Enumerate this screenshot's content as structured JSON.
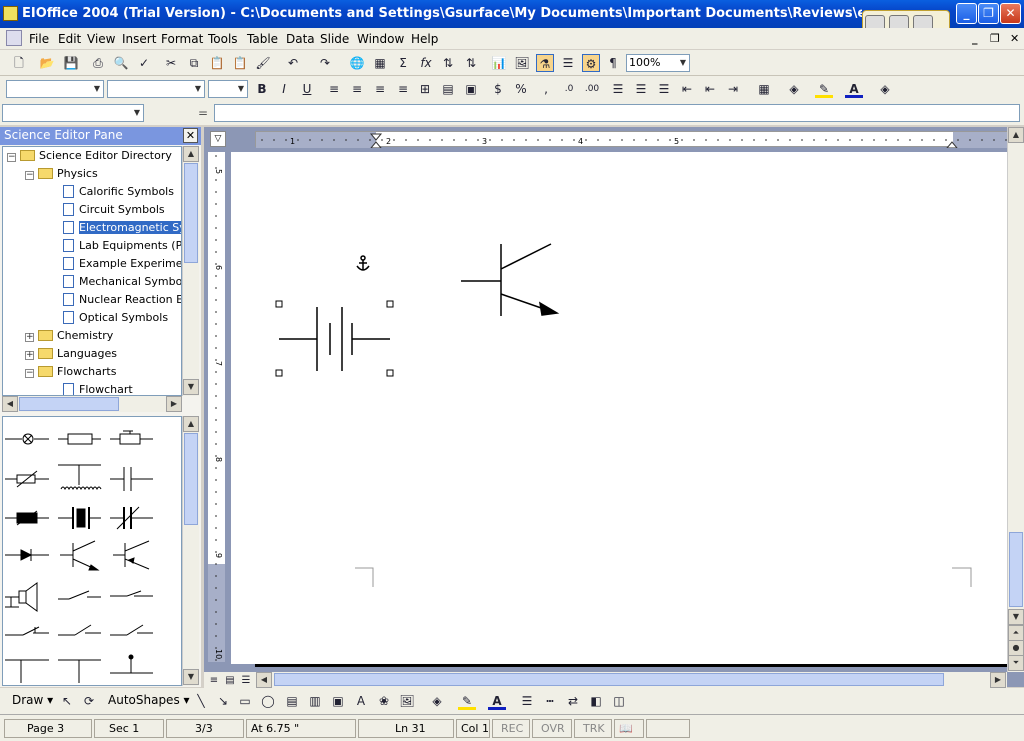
{
  "window": {
    "title": "EIOffice 2004 (Trial Version) - C:\\Documents and Settings\\Gsurface\\My Documents\\Important Documents\\Reviews\\eioffice\\EIOfficei.eio"
  },
  "menubar": {
    "items": [
      "File",
      "Edit",
      "View",
      "Insert",
      "Format",
      "Tools",
      "Table",
      "Data",
      "Slide",
      "Window",
      "Help"
    ]
  },
  "toolbar": {
    "zoom_value": "100%",
    "pilcrow": "¶",
    "sigma": "Σ",
    "fx": "fx",
    "dollar": "$",
    "percent": "%",
    "comma": ",",
    "bold": "B",
    "italic": "I",
    "underline": "U",
    "font_color_letter": "A",
    "addr_equals": "="
  },
  "pane": {
    "title": "Science Editor Pane",
    "tree": [
      {
        "label": "Science Editor Directory",
        "type": "folder",
        "level": 0,
        "expander": "−"
      },
      {
        "label": "Physics",
        "type": "folder",
        "level": 1,
        "expander": "−"
      },
      {
        "label": "Calorific Symbols",
        "type": "doc",
        "level": 2
      },
      {
        "label": "Circuit Symbols",
        "type": "doc",
        "level": 2
      },
      {
        "label": "Electromagnetic Sym",
        "type": "doc",
        "level": 2,
        "selected": true
      },
      {
        "label": "Lab Equipments (Phy",
        "type": "doc",
        "level": 2
      },
      {
        "label": "Example Experiments",
        "type": "doc",
        "level": 2
      },
      {
        "label": "Mechanical Symbols",
        "type": "doc",
        "level": 2
      },
      {
        "label": "Nuclear Reaction Exp",
        "type": "doc",
        "level": 2
      },
      {
        "label": "Optical Symbols",
        "type": "doc",
        "level": 2
      },
      {
        "label": "Chemistry",
        "type": "folder",
        "level": 1,
        "expander": "+"
      },
      {
        "label": "Languages",
        "type": "folder",
        "level": 1,
        "expander": "+"
      },
      {
        "label": "Flowcharts",
        "type": "folder",
        "level": 1,
        "expander": "−"
      },
      {
        "label": "Flowchart",
        "type": "doc",
        "level": 2
      }
    ],
    "palette_symbols": [
      "lamp",
      "resistor",
      "rheostat",
      "variable-resistor",
      "inductor-tap",
      "capacitor",
      "diode-block",
      "crystal",
      "variable-capacitor",
      "diode",
      "npn-transistor",
      "pnp-transistor",
      "speaker",
      "switch",
      "switch-open",
      "switch-double",
      "switch-double-2",
      "switch-double-3",
      "ground-t",
      "ground-t2",
      "antenna-ground"
    ]
  },
  "ruler": {
    "h_numbers": [
      "1",
      "2",
      "3",
      "4",
      "5"
    ],
    "v_numbers": [
      "5",
      "6",
      "7",
      "8",
      "9",
      "10"
    ]
  },
  "drawbar": {
    "draw_label": "Draw",
    "autoshapes_label": "AutoShapes"
  },
  "status": {
    "page": "Page 3",
    "sec": "Sec 1",
    "count": "3/3",
    "at": "At 6.75 \"",
    "ln": "Ln 31",
    "col": "Col 1",
    "rec": "REC",
    "ovr": "OVR",
    "trk": "TRK"
  }
}
